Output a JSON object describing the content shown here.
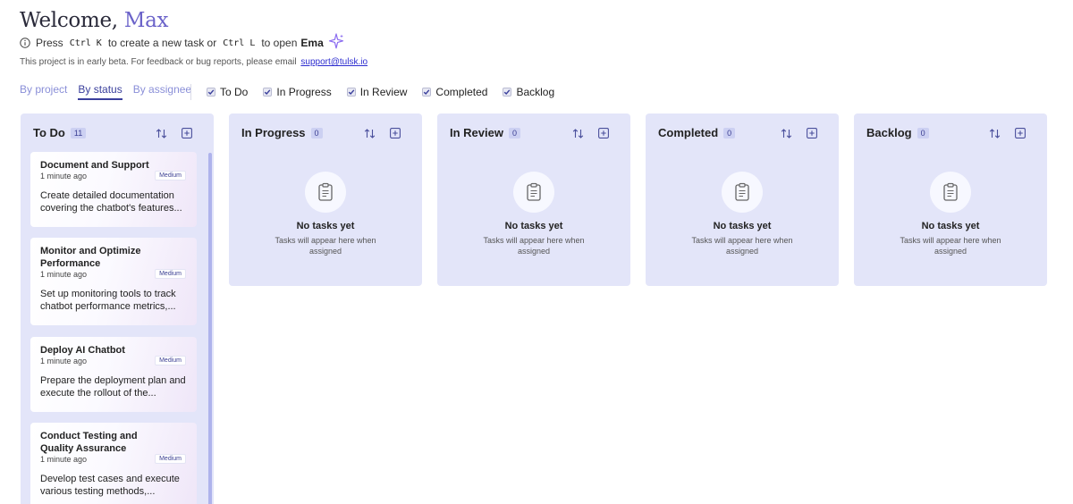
{
  "header": {
    "welcome_prefix": "Welcome,",
    "user_name": "Max",
    "hint_press": "Press",
    "shortcut_new": "Ctrl K",
    "hint_new": "to create a new task or",
    "shortcut_ema": "Ctrl L",
    "hint_open": "to open",
    "ema": "Ema",
    "beta_text": "This project is in early beta. For feedback or bug reports, please email",
    "beta_email": "support@tulsk.io"
  },
  "view_tabs": [
    "By project",
    "By status",
    "By assignee"
  ],
  "active_view": "By status",
  "filters": [
    {
      "label": "To Do",
      "checked": true
    },
    {
      "label": "In Progress",
      "checked": true
    },
    {
      "label": "In Review",
      "checked": true
    },
    {
      "label": "Completed",
      "checked": true
    },
    {
      "label": "Backlog",
      "checked": true
    }
  ],
  "columns": {
    "todo": {
      "title": "To Do",
      "count": "11",
      "cards": [
        {
          "title": "Document and Support",
          "time": "1 minute ago",
          "priority": "Medium",
          "description": "Create detailed documentation covering the chatbot's features..."
        },
        {
          "title": "Monitor and Optimize Performance",
          "time": "1 minute ago",
          "priority": "Medium",
          "description": "Set up monitoring tools to track chatbot performance metrics,..."
        },
        {
          "title": "Deploy AI Chatbot",
          "time": "1 minute ago",
          "priority": "Medium",
          "description": "Prepare the deployment plan and execute the rollout of the..."
        },
        {
          "title": "Conduct Testing and Quality Assurance",
          "time": "1 minute ago",
          "priority": "Medium",
          "description": "Develop test cases and execute various testing methods,..."
        }
      ]
    },
    "in_progress": {
      "title": "In Progress",
      "count": "0"
    },
    "in_review": {
      "title": "In Review",
      "count": "0"
    },
    "completed": {
      "title": "Completed",
      "count": "0"
    },
    "backlog": {
      "title": "Backlog",
      "count": "0"
    }
  },
  "empty_state": {
    "title": "No tasks yet",
    "subtitle": "Tasks will appear here when assigned"
  },
  "colors": {
    "accent": "#6b63c9",
    "column_bg": "#e3e5f9",
    "active_tab": "#3a3f9c",
    "link": "#2d2dd0"
  },
  "icons": [
    "info-icon",
    "sparkle-icon",
    "check-icon",
    "sort-icon",
    "add-icon",
    "clipboard-icon"
  ]
}
